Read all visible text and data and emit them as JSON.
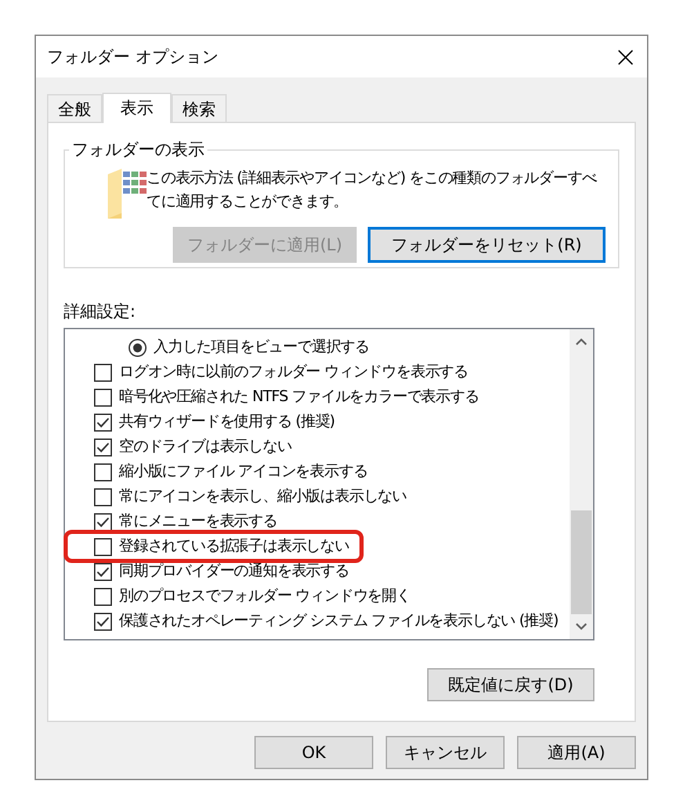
{
  "window": {
    "title": "フォルダー オプション"
  },
  "tabs": [
    {
      "label": "全般",
      "selected": false
    },
    {
      "label": "表示",
      "selected": true
    },
    {
      "label": "検索",
      "selected": false
    }
  ],
  "folder_views": {
    "title": "フォルダーの表示",
    "description": "この表示方法 (詳細表示やアイコンなど) をこの種類のフォルダーすべてに適用することができます。",
    "buttons": [
      {
        "label": "フォルダーに適用(L)",
        "disabled": true,
        "focused": false
      },
      {
        "label": "フォルダーをリセット(R)",
        "disabled": false,
        "focused": true
      }
    ]
  },
  "advanced": {
    "label": "詳細設定:",
    "items": [
      {
        "kind": "radio",
        "label": "入力した項目をビューで選択する",
        "checked": true,
        "highlighted": false
      },
      {
        "kind": "checkbox",
        "label": "ログオン時に以前のフォルダー ウィンドウを表示する",
        "checked": false,
        "highlighted": false
      },
      {
        "kind": "checkbox",
        "label": "暗号化や圧縮された NTFS ファイルをカラーで表示する",
        "checked": false,
        "highlighted": false
      },
      {
        "kind": "checkbox",
        "label": "共有ウィザードを使用する (推奨)",
        "checked": true,
        "highlighted": false
      },
      {
        "kind": "checkbox",
        "label": "空のドライブは表示しない",
        "checked": true,
        "highlighted": false
      },
      {
        "kind": "checkbox",
        "label": "縮小版にファイル アイコンを表示する",
        "checked": false,
        "highlighted": false
      },
      {
        "kind": "checkbox",
        "label": "常にアイコンを表示し、縮小版は表示しない",
        "checked": false,
        "highlighted": false
      },
      {
        "kind": "checkbox",
        "label": "常にメニューを表示する",
        "checked": true,
        "highlighted": false
      },
      {
        "kind": "checkbox",
        "label": "登録されている拡張子は表示しない",
        "checked": false,
        "highlighted": true
      },
      {
        "kind": "checkbox",
        "label": "同期プロバイダーの通知を表示する",
        "checked": true,
        "highlighted": false
      },
      {
        "kind": "checkbox",
        "label": "別のプロセスでフォルダー ウィンドウを開く",
        "checked": false,
        "highlighted": false
      },
      {
        "kind": "checkbox",
        "label": "保護されたオペレーティング システム ファイルを表示しない (推奨)",
        "checked": true,
        "highlighted": false
      }
    ],
    "restore_button": "既定値に戻す(D)"
  },
  "buttons": [
    "OK",
    "キャンセル",
    "適用(A)"
  ]
}
